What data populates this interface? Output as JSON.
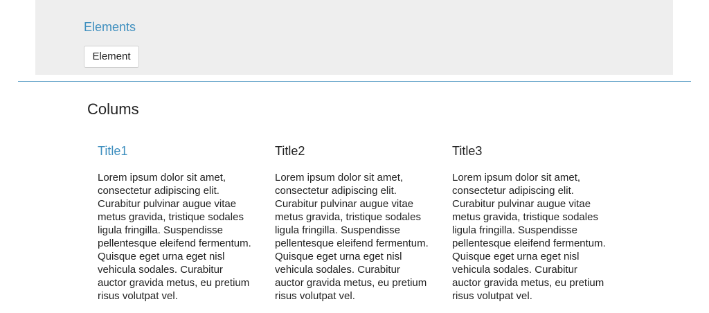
{
  "elements_panel": {
    "title": "Elements",
    "button_label": "Element"
  },
  "section": {
    "title": "Colums"
  },
  "columns": [
    {
      "title": "Title1",
      "text": "Lorem ipsum dolor sit amet, consectetur adipiscing elit. Curabitur pulvinar augue vitae metus gravida, tristique sodales ligula fringilla. Suspendisse pellentesque eleifend fermentum. Quisque eget urna eget nisl vehicula sodales. Curabitur auctor gravida metus, eu pretium risus volutpat vel."
    },
    {
      "title": "Title2",
      "text": "Lorem ipsum dolor sit amet, consectetur adipiscing elit. Curabitur pulvinar augue vitae metus gravida, tristique sodales ligula fringilla. Suspendisse pellentesque eleifend fermentum. Quisque eget urna eget nisl vehicula sodales. Curabitur auctor gravida metus, eu pretium risus volutpat vel."
    },
    {
      "title": "Title3",
      "text": "Lorem ipsum dolor sit amet, consectetur adipiscing elit. Curabitur pulvinar augue vitae metus gravida, tristique sodales ligula fringilla. Suspendisse pellentesque eleifend fermentum. Quisque eget urna eget nisl vehicula sodales. Curabitur auctor gravida metus, eu pretium risus volutpat vel."
    }
  ],
  "colors": {
    "accent": "#3f8fbf",
    "panel_background": "#eeeeee",
    "divider": "#5b9ec6",
    "text": "#222222"
  }
}
